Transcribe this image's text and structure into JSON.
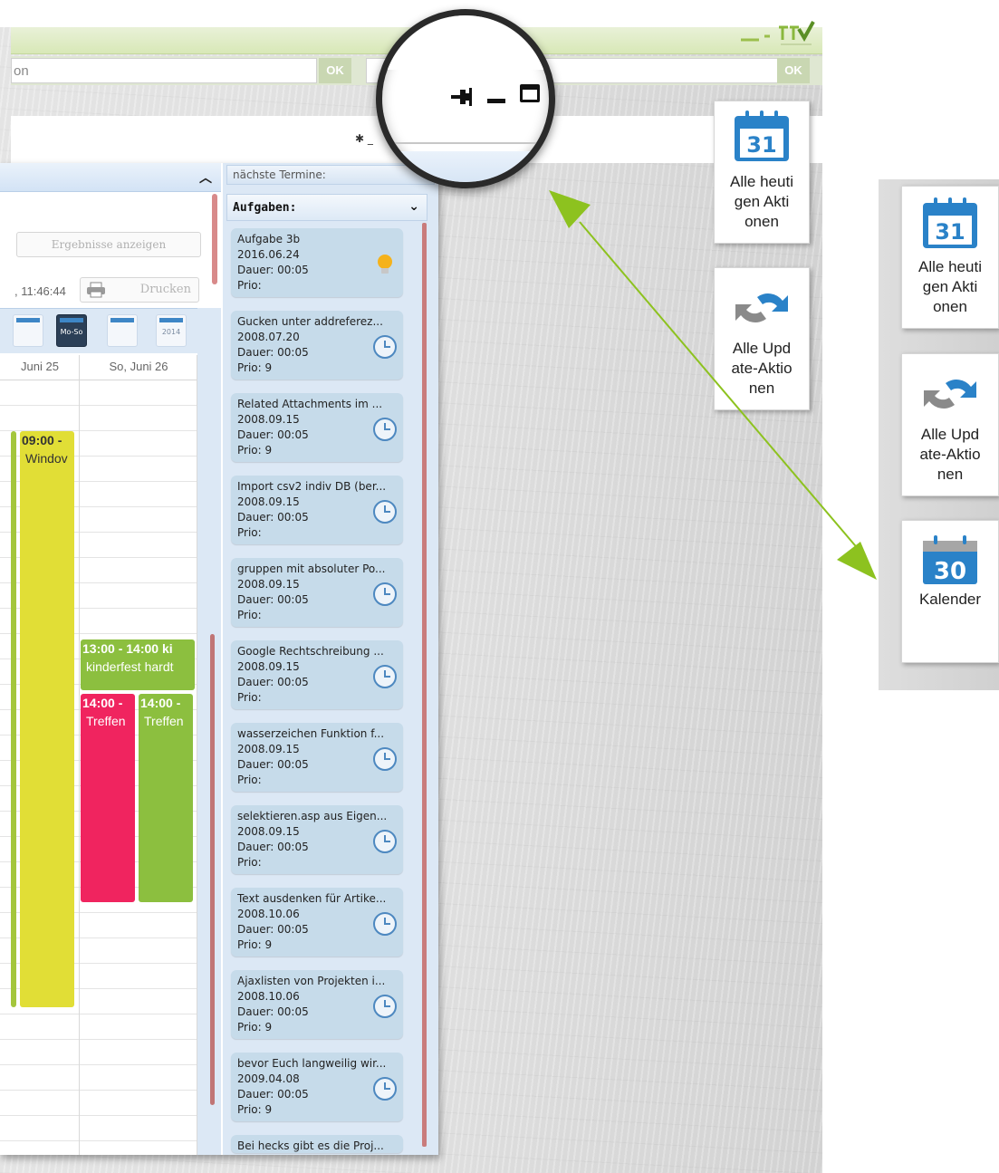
{
  "header": {
    "search_value": "on",
    "ok_label": "OK",
    "ok2_label": "OK"
  },
  "calendar": {
    "results_button": "Ergebnisse anzeigen",
    "time_text": ", 11:46:44",
    "print_button": "Drucken",
    "view_buttons": [
      "",
      "Mo-So",
      "",
      "2014"
    ],
    "day_headers": [
      "Juni 25",
      "So, Juni 26"
    ],
    "events": [
      {
        "time": "09:00 -",
        "title": "Windov"
      },
      {
        "time": "13:00 - 14:00 ki",
        "title": "kinderfest hardt"
      },
      {
        "time": "14:00 -",
        "title": "Treffen"
      },
      {
        "time": "14:00 -",
        "title": "Treffen"
      }
    ]
  },
  "side_panel": {
    "next_label": "nächste Termine:",
    "tasks_label": "Aufgaben:",
    "tasks": [
      {
        "title": "Aufgabe 3b",
        "date": "2016.06.24",
        "duration": "Dauer: 00:05",
        "prio": "Prio:",
        "icon": "lightbulb-icon"
      },
      {
        "title": "Gucken unter addreferez...",
        "date": "2008.07.20",
        "duration": "Dauer: 00:05",
        "prio": "Prio: 9",
        "icon": "clock-icon"
      },
      {
        "title": "Related Attachments im ...",
        "date": "2008.09.15",
        "duration": "Dauer: 00:05",
        "prio": "Prio: 9",
        "icon": "clock-icon"
      },
      {
        "title": "Import csv2 indiv DB (ber...",
        "date": "2008.09.15",
        "duration": "Dauer: 00:05",
        "prio": "Prio:",
        "icon": "clock-icon"
      },
      {
        "title": "gruppen mit absoluter Po...",
        "date": "2008.09.15",
        "duration": "Dauer: 00:05",
        "prio": "Prio:",
        "icon": "clock-icon"
      },
      {
        "title": "Google Rechtschreibung ...",
        "date": "2008.09.15",
        "duration": "Dauer: 00:05",
        "prio": "Prio:",
        "icon": "clock-icon"
      },
      {
        "title": "wasserzeichen Funktion f...",
        "date": "2008.09.15",
        "duration": "Dauer: 00:05",
        "prio": "Prio:",
        "icon": "clock-icon"
      },
      {
        "title": "selektieren.asp aus Eigen...",
        "date": "2008.09.15",
        "duration": "Dauer: 00:05",
        "prio": "Prio:",
        "icon": "clock-icon"
      },
      {
        "title": "Text ausdenken für Artike...",
        "date": "2008.10.06",
        "duration": "Dauer: 00:05",
        "prio": "Prio: 9",
        "icon": "clock-icon"
      },
      {
        "title": "Ajaxlisten von Projekten i...",
        "date": "2008.10.06",
        "duration": "Dauer: 00:05",
        "prio": "Prio: 9",
        "icon": "clock-icon"
      },
      {
        "title": "bevor Euch langweilig wir...",
        "date": "2009.04.08",
        "duration": "Dauer: 00:05",
        "prio": "Prio: 9",
        "icon": "clock-icon"
      },
      {
        "title": "Bei hecks gibt es die Proj...",
        "date": "",
        "duration": "",
        "prio": "",
        "icon": ""
      }
    ]
  },
  "tiles_middle": [
    {
      "label": "Alle heuti gen Akti onen",
      "icon_text": "31",
      "icon": "calendar-icon"
    },
    {
      "label": "Alle Upd ate-Aktio nen",
      "icon": "sync-icon"
    }
  ],
  "tiles_right": [
    {
      "label": "Alle heuti gen Akti onen",
      "icon_text": "31",
      "icon": "calendar-icon"
    },
    {
      "label": "Alle Upd ate-Aktio nen",
      "icon": "sync-icon"
    },
    {
      "label": "Kalender",
      "icon_text": "30",
      "icon": "calendar-icon"
    }
  ],
  "colors": {
    "accent_green": "#8cbf3f",
    "arrow_green": "#8dc21f",
    "calendar_blue": "#2a82c8",
    "event_yellow": "#e1de36",
    "event_pink": "#f0245f"
  }
}
